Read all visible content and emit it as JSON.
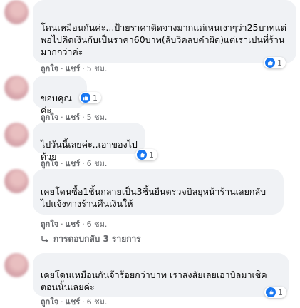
{
  "comments": [
    {
      "text": "โดนเหมือนกันค่ะ...ป้ายราคาติดจางมากแต่เหนเงาๆว่า25บาทแต่พอไปคิดเงินกับเป็นราคา60บาท(ลับวิคลบคำผิด)แต่เราเปนที่ร้านมากกว่าค่ะ",
      "like_label": "ถูกใจ",
      "reply_label": "แชร์",
      "time": "5 ชม.",
      "reaction_count": "1"
    },
    {
      "text": "ขอบคุณค่ะ",
      "like_label": "ถูกใจ",
      "reply_label": "แชร์",
      "time": "5 ชม.",
      "reaction_count": "1"
    },
    {
      "text": "ไปวันนี้เลยค่ะ..เอาของไปด้วย",
      "like_label": "ถูกใจ",
      "reply_label": "แชร์",
      "time": "6 ชม.",
      "reaction_count": "1"
    },
    {
      "text": "เคยโดนซื้อ1ชิ้นกลายเป็น3ชิ้นยืนตรวจบิลยุหน้าร้านเลยกลับไปแจ้งทางร้านคืนเงินให้",
      "like_label": "ถูกใจ",
      "reply_label": "แชร์",
      "time": "6 ชม.",
      "reaction_count": ""
    },
    {
      "text": "เคยโดนเหมือนกันจ้าร้อยกว่าบาท เราสงสัยเลยเอาบิลมาเช็คตอนนั้นเลยค่ะ",
      "like_label": "ถูกใจ",
      "reply_label": "แชร์",
      "time": "6 ชม.",
      "reaction_count": "1"
    }
  ],
  "replies_link": "การตอบกลับ 3 รายการ",
  "colors": {
    "like_blue": "#1877f2",
    "bubble": "#f0f2f5",
    "meta": "#65676b"
  }
}
